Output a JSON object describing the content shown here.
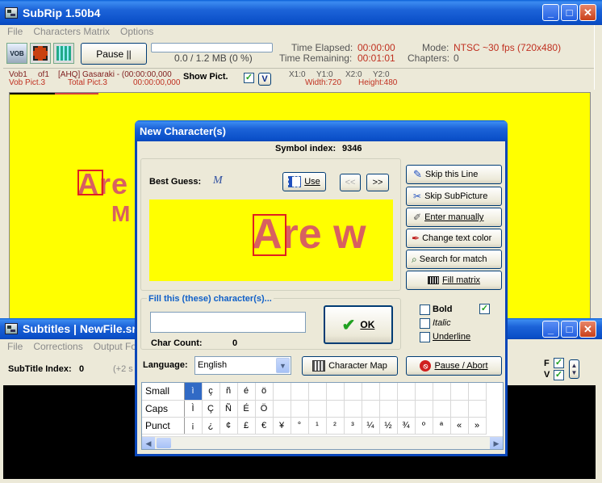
{
  "main_window": {
    "title": "SubRip 1.50b4",
    "menu": [
      "File",
      "Characters Matrix",
      "Options"
    ],
    "toolbar": {
      "vob_label": "VOB",
      "pause_label": "Pause ||",
      "progress_text": "0.0 / 1.2 MB (0 %)",
      "progress_fraction": 0.0,
      "time_elapsed_label": "Time Elapsed:",
      "time_elapsed_value": "00:00:00",
      "time_remaining_label": "Time Remaining:",
      "time_remaining_value": "00:01:01",
      "mode_label": "Mode:",
      "mode_value": "NTSC ~30 fps (720x480)",
      "chapters_label": "Chapters:",
      "chapters_value": "0"
    },
    "info": {
      "vob": "Vob1",
      "of": "of1",
      "subtitle_text": "[AHQ] Gasaraki - (00:00:00,000",
      "vob_pict": "Vob Pict.3",
      "total_pict": "Total Pict.3",
      "time2": "00:00:00,000",
      "show_pict_label": "Show Pict.",
      "v_label": "V",
      "x1": "X1:0",
      "y1": "Y1:0",
      "x2": "X2:0",
      "y2": "Y2:0",
      "width": "Width:720",
      "height": "Height:480"
    },
    "preview_text_line1": "Are y",
    "preview_text_line2": "M"
  },
  "subtitles_window": {
    "title": "Subtitles | NewFile.srt",
    "menu": [
      "File",
      "Corrections",
      "Output Form"
    ],
    "subtitle_index_label": "SubTitle Index:",
    "subtitle_index_value": "0",
    "extra": "(+2 s",
    "f_label": "F",
    "v_label": "V"
  },
  "dialog": {
    "title": "New Character(s)",
    "symbol_index_label": "Symbol index:",
    "symbol_index_value": "9346",
    "best_guess_label": "Best Guess:",
    "best_guess_value": "M",
    "use_label": "Use",
    "prev_label": "<<",
    "next_label": ">>",
    "preview_text": "Are w",
    "fill_label": "Fill this (these) character(s)...",
    "input_value": "",
    "char_count_label": "Char Count:",
    "char_count_value": "0",
    "ok_label": "OK",
    "buttons": {
      "skip_line": "Skip this Line",
      "skip_subpicture": "Skip SubPicture",
      "enter_manually": "Enter manually",
      "change_text_color": "Change text color",
      "search_for_match": "Search for match",
      "fill_matrix": "Fill matrix",
      "pause_abort": "Pause / Abort",
      "character_map": "Character Map"
    },
    "bold_label": "Bold",
    "italic_label": "Italic",
    "underline_label": "Underline",
    "language_label": "Language:",
    "language_value": "English",
    "rows": [
      {
        "name": "Small",
        "chars": [
          "ì",
          "ç",
          "ñ",
          "é",
          "ö",
          "",
          "",
          "",
          "",
          "",
          "",
          "",
          "",
          "",
          "",
          "",
          ""
        ]
      },
      {
        "name": "Caps",
        "chars": [
          "Ì",
          "Ç",
          "Ñ",
          "É",
          "Ö",
          "",
          "",
          "",
          "",
          "",
          "",
          "",
          "",
          "",
          "",
          "",
          ""
        ]
      },
      {
        "name": "Punct",
        "chars": [
          "¡",
          "¿",
          "¢",
          "£",
          "€",
          "¥",
          "°",
          "¹",
          "²",
          "³",
          "¼",
          "½",
          "¾",
          "º",
          "ª",
          "«",
          "»",
          "©"
        ]
      }
    ]
  },
  "colors": {
    "preview_bg": "#FFFF00",
    "preview_text": "#D86060",
    "accent_blue": "#0A4FC8",
    "selected_cell": "#316AC5"
  }
}
